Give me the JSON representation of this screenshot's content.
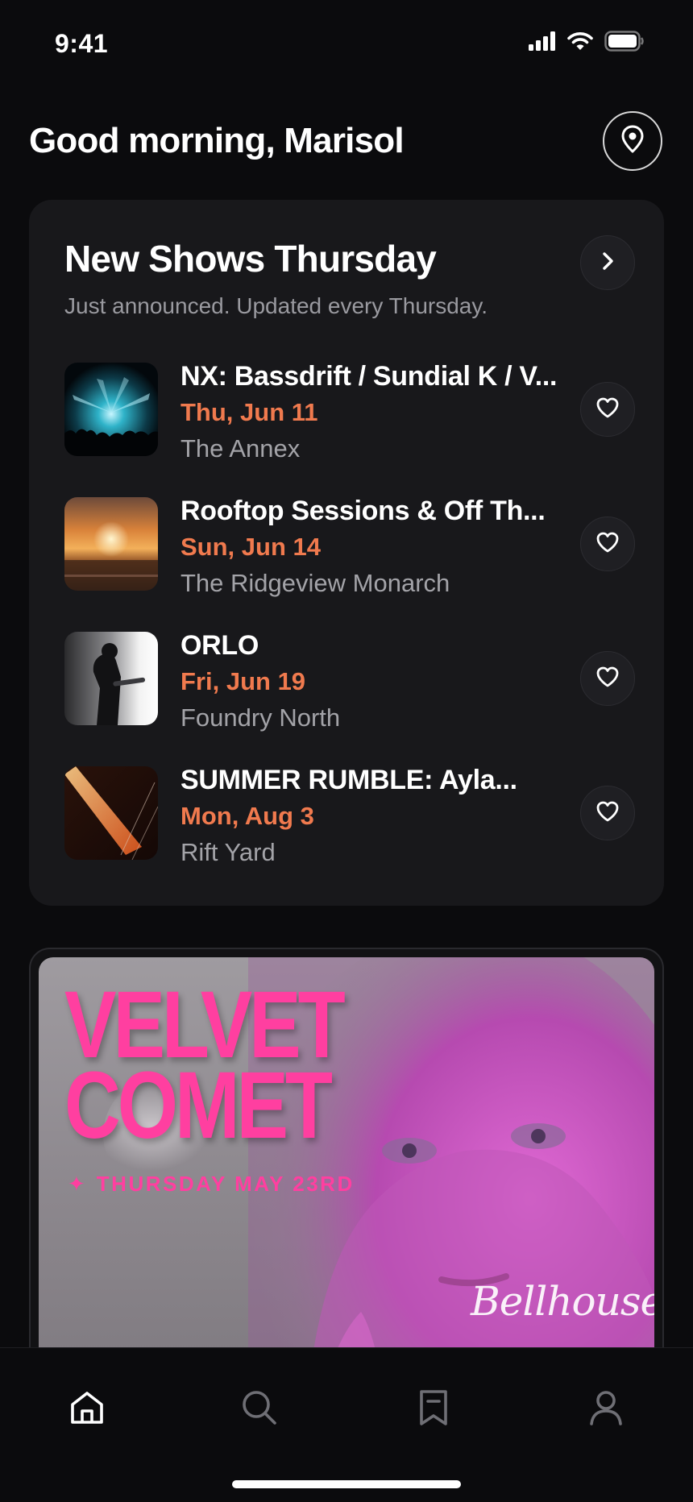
{
  "status_bar": {
    "time": "9:41",
    "icons": [
      "cellular-icon",
      "wifi-icon",
      "battery-icon"
    ]
  },
  "header": {
    "greeting": "Good morning, Marisol",
    "location_icon": "location-pin-icon"
  },
  "shows_card": {
    "title": "New Shows Thursday",
    "subtitle": "Just announced. Updated every Thursday.",
    "arrow_icon": "chevron-right-icon",
    "shows": [
      {
        "title": "NX: Bassdrift / Sundial K / V...",
        "date": "Thu, Jun 11",
        "venue": "The Annex",
        "image": "concert-lights-thumbnail",
        "favorite_icon": "heart-icon"
      },
      {
        "title": "Rooftop Sessions & Off Th...",
        "date": "Sun, Jun 14",
        "venue": "The Ridgeview Monarch",
        "image": "sunset-thumbnail",
        "favorite_icon": "heart-icon"
      },
      {
        "title": "ORLO",
        "date": "Fri, Jun 19",
        "venue": "Foundry North",
        "image": "guitarist-thumbnail",
        "favorite_icon": "heart-icon"
      },
      {
        "title": "SUMMER RUMBLE: Ayla...",
        "date": "Mon, Aug 3",
        "venue": "Rift Yard",
        "image": "stage-beam-thumbnail",
        "favorite_icon": "heart-icon"
      }
    ]
  },
  "promo": {
    "title_line1": "VELVET",
    "title_line2": "COMET",
    "star": "✦",
    "date": "THURSDAY MAY 23RD",
    "venue_script": "Bellhouse"
  },
  "tab_bar": {
    "tabs": [
      {
        "icon": "home-icon",
        "active": true
      },
      {
        "icon": "search-icon",
        "active": false
      },
      {
        "icon": "bookmark-icon",
        "active": false
      },
      {
        "icon": "profile-icon",
        "active": false
      }
    ]
  },
  "colors": {
    "accent": "#f07a4e",
    "promo_pink": "#ff3fa0",
    "card_bg": "#18181b",
    "page_bg": "#0b0b0d"
  }
}
